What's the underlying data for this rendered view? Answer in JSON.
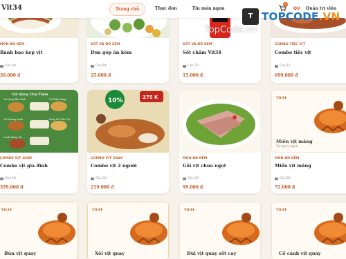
{
  "header": {
    "brand": "Vit34",
    "nav": [
      "Trang chủ",
      "Thực đơn",
      "Tin món ngon"
    ],
    "cart_count": "0",
    "lang": "QV",
    "admin": "Quản trị viên"
  },
  "watermark": {
    "logo": "TOPCODE.VN",
    "logo_main": "TOPCODE",
    "logo_ext": ".VN",
    "center": "TopCode.vn",
    "box_text": "T"
  },
  "placeholder_label": "Vit34",
  "row1": [
    {
      "cat": "MÓN ĂN KÈM",
      "name": "Bánh bao kẹp vịt",
      "sold": "Còn 40",
      "price": "39.000 đ"
    },
    {
      "cat": "SỐT VÀ ĐỒ KÈM",
      "name": "Dưa góp ăn kèm",
      "sold": "Còn 64",
      "price": "25.000 đ"
    },
    {
      "cat": "SỐT VÀ ĐỒ KÈM",
      "name": "Sốt chấm Vit34",
      "sold": "Còn 70",
      "price": "15.000 đ"
    },
    {
      "cat": "COMBO TIỆC VỊT",
      "name": "Combo tiệc vịt",
      "sold": "Còn 12",
      "price": "699.000 đ"
    }
  ],
  "row2": [
    {
      "cat": "COMBO VỊT QUAY",
      "name": "Combo vịt gia đình",
      "sold": "Còn 18",
      "price": "359.000 đ"
    },
    {
      "cat": "COMBO VỊT QUAY",
      "name": "Combo vịt 2 người",
      "sold": "Còn 33",
      "price": "219.000 đ"
    },
    {
      "cat": "MÓN ĂN KÈM",
      "name": "Gỏi vịt chua ngọt",
      "sold": "Còn 23",
      "price": "99.000 đ"
    },
    {
      "cat": "MÓN ĂN KÈM",
      "name": "Miến vịt măng",
      "sold": "Còn 29",
      "price": "72.000 đ",
      "ph_title": "Miến vịt măng",
      "ph_sub": "Vịt quay ngon"
    }
  ],
  "row3": [
    {
      "name": "Bún vịt quay"
    },
    {
      "name": "Xôi vịt quay"
    },
    {
      "name": "Đùi vịt quay sốt cay"
    },
    {
      "name": "Cổ cánh vịt quay"
    }
  ],
  "promo": {
    "badge": "10%",
    "price_tag": "275 K",
    "menu_title": "Vịt Quay Chợ Tiệm",
    "labels": [
      "Vịt Quay Bắc Kinh",
      "Vịt Hấp Gừng",
      "Vịt Nướng Muối",
      "Lòng Mề Xào Tỏi",
      "Canh Măng Vịt"
    ]
  },
  "colors": {
    "accent": "#d3531d",
    "price": "#c7561f",
    "background": "#f6f1ea"
  }
}
